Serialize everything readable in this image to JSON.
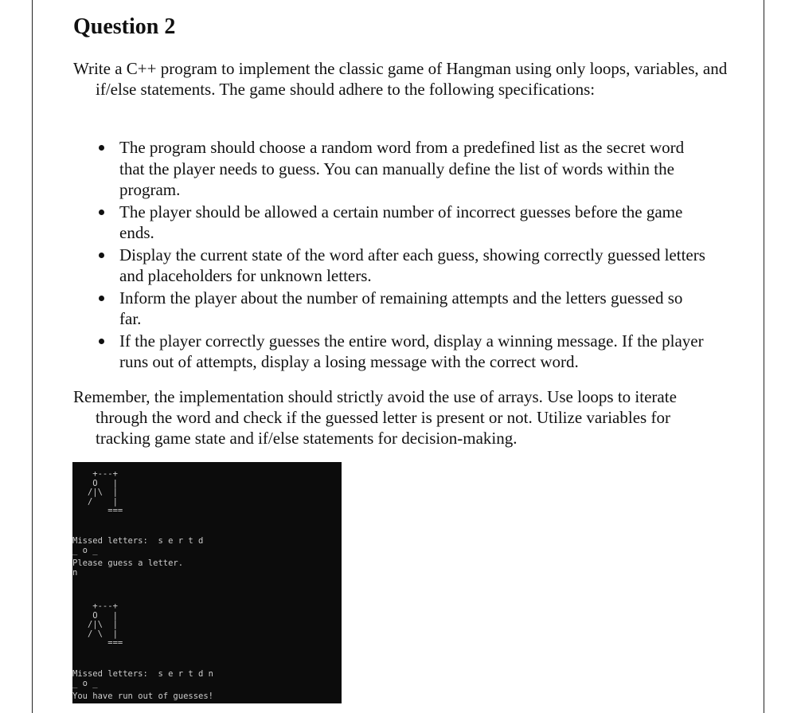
{
  "document": {
    "heading": "Question 2",
    "intro": "Write a C++ program to implement the classic game of Hangman using only loops, variables, and if/else statements. The game should adhere to the following specifications:",
    "bullets": [
      "The program should choose a random word from a predefined list as the secret word that the player needs to guess. You can manually define the list of words within the program.",
      "The player should be allowed a certain number of incorrect guesses before the game ends.",
      "Display the current state of the word after each guess, showing correctly guessed letters and placeholders for unknown letters.",
      "Inform the player about the number of remaining attempts and the letters guessed so far.",
      "If the player correctly guesses the entire word, display a winning message. If the player runs out of attempts, display a losing message with the correct word."
    ],
    "outro": "Remember, the implementation should strictly avoid the use of arrays. Use loops to iterate through the word and check if the guessed letter is present or not. Utilize variables for tracking game state and if/else statements for decision-making."
  },
  "console": {
    "gallows_1": "    +---+\n    O   |\n   /|\\  |\n   /    |\n       ===",
    "missed_1": "Missed letters:  s e r t d",
    "word_1": "_ o _",
    "prompt": "Please guess a letter.",
    "input": "n",
    "gallows_2": "    +---+\n    O   |\n   /|\\  |\n   / \\  |\n       ===",
    "missed_2": "Missed letters:  s e r t d n",
    "word_2": "_ o _",
    "result": "You have run out of guesses!"
  }
}
